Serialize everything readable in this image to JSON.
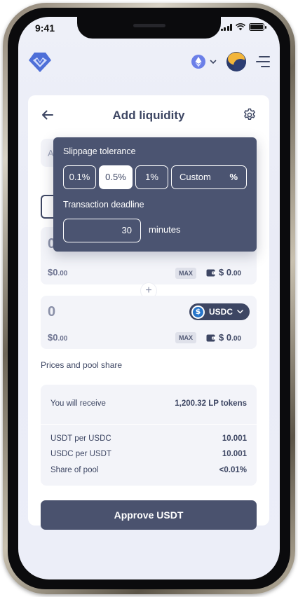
{
  "status_bar": {
    "time": "9:41"
  },
  "header": {
    "logo_icon": "shield-logo-icon",
    "network_icon": "ethereum-icon"
  },
  "card": {
    "title": "Add liquidity",
    "partial_label": "A",
    "first_field": {
      "amount": "0",
      "usd_value": "$0",
      "usd_cents": ".00",
      "max_label": "MAX",
      "balance": "$ 0",
      "balance_cents": ".00"
    },
    "second_field": {
      "amount": "0",
      "token": "USDC",
      "usd_value": "$0",
      "usd_cents": ".00",
      "max_label": "MAX",
      "balance": "$ 0",
      "balance_cents": ".00"
    },
    "plus": "+",
    "section_label": "Prices and pool share",
    "receive": {
      "label": "You will receive",
      "value": "1,200.32 LP tokens"
    },
    "rates": [
      {
        "label": "USDT per USDC",
        "value": "10.001"
      },
      {
        "label": "USDC per USDT",
        "value": "10.001"
      },
      {
        "label": "Share of pool",
        "value": "<0.01%"
      }
    ],
    "approve_label": "Approve USDT"
  },
  "popover": {
    "slippage_title": "Slippage tolerance",
    "options": [
      "0.1%",
      "0.5%",
      "1%"
    ],
    "selected_option": "0.5%",
    "custom_placeholder": "Custom",
    "custom_suffix": "%",
    "deadline_title": "Transaction deadline",
    "deadline_value": "30",
    "deadline_unit": "minutes"
  },
  "colors": {
    "accent": "#3d4663",
    "popover_bg": "#4b5471",
    "usdc": "#2775ca",
    "logo": "#4e6fd8"
  }
}
